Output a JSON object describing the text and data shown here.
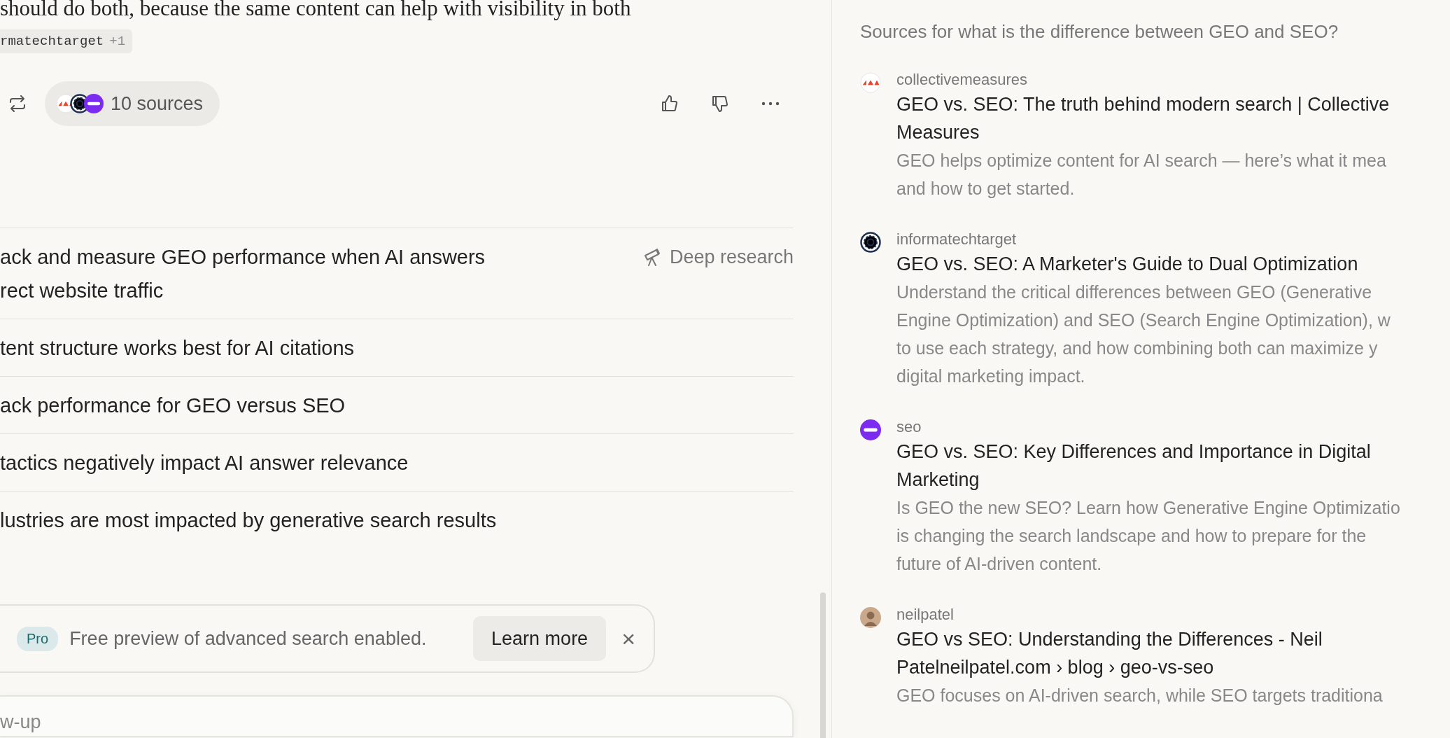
{
  "answer": {
    "text": "should do both, because the same content can help with visibility in both",
    "citation": {
      "label": "rmatechtarget",
      "extra": "+1"
    }
  },
  "actions": {
    "sources_label": "10 sources"
  },
  "related": [
    {
      "lines": [
        "ack and measure GEO performance when AI answers",
        "rect website traffic"
      ],
      "badge": "Deep research"
    },
    {
      "lines": [
        "tent structure works best for AI citations"
      ]
    },
    {
      "lines": [
        "ack performance for GEO versus SEO"
      ]
    },
    {
      "lines": [
        "tactics negatively impact AI answer relevance"
      ]
    },
    {
      "lines": [
        "lustries are most impacted by generative search results"
      ]
    }
  ],
  "banner": {
    "badge": "Pro",
    "text": "Free preview of advanced search enabled.",
    "button": "Learn more",
    "close": "×"
  },
  "followup": {
    "placeholder": "w-up"
  },
  "sources_panel": {
    "heading": "Sources for what is the difference between GEO and SEO?",
    "items": [
      {
        "kind": "triangles",
        "domain": "collectivemeasures",
        "title": [
          "GEO vs. SEO: The truth behind modern search | Collective",
          "Measures"
        ],
        "description": [
          "GEO helps optimize content for AI search — here’s what it mea",
          "and how to get started."
        ]
      },
      {
        "kind": "rings",
        "domain": "informatechtarget",
        "title": [
          "GEO vs. SEO: A Marketer's Guide to Dual Optimization"
        ],
        "description": [
          "Understand the critical differences between GEO (Generative",
          "Engine Optimization) and SEO (Search Engine Optimization), w",
          "to use each strategy, and how combining both can maximize y",
          "digital marketing impact."
        ]
      },
      {
        "kind": "seo",
        "domain": "seo",
        "title": [
          "GEO vs. SEO: Key Differences and Importance in Digital",
          "Marketing"
        ],
        "description": [
          "Is GEO the new SEO? Learn how Generative Engine Optimizatio",
          "is changing the search landscape and how to prepare for the",
          "future of AI-driven content."
        ]
      },
      {
        "kind": "avatar",
        "domain": "neilpatel",
        "title": [
          "GEO vs SEO: Understanding the Differences - Neil",
          "Patelneilpatel.com › blog › geo-vs-seo"
        ],
        "description": [
          "GEO focuses on AI-driven search, while SEO targets traditiona"
        ]
      }
    ]
  }
}
